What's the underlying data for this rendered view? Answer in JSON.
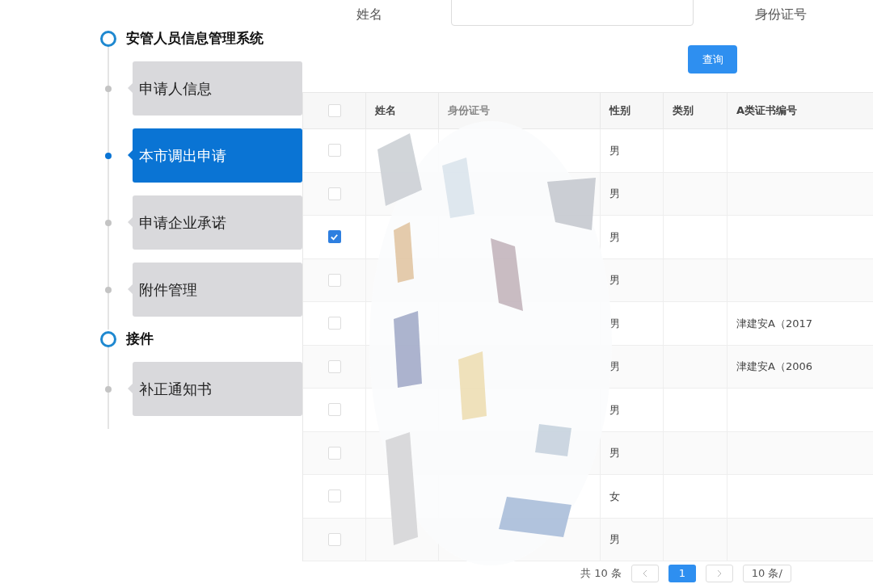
{
  "sidebar": {
    "groups": [
      {
        "title": "安管人员信息管理系统",
        "items": [
          {
            "label": "申请人信息",
            "selected": false
          },
          {
            "label": "本市调出申请",
            "selected": true
          },
          {
            "label": "申请企业承诺",
            "selected": false
          },
          {
            "label": "附件管理",
            "selected": false
          }
        ]
      },
      {
        "title": "接件",
        "items": [
          {
            "label": "补正通知书",
            "selected": false
          }
        ]
      }
    ]
  },
  "search_form": {
    "fields": [
      {
        "label": "姓名",
        "has_input": true
      },
      {
        "label": "身份证号",
        "has_input": false
      }
    ],
    "button": "查询"
  },
  "table": {
    "header_checked": false,
    "columns": [
      "姓名",
      "身份证号",
      "性别",
      "类别",
      "A类证书编号"
    ],
    "rows": [
      {
        "checked": false,
        "gender": "男"
      },
      {
        "checked": false,
        "gender": "男"
      },
      {
        "checked": true,
        "gender": "男"
      },
      {
        "checked": false,
        "gender": "男"
      },
      {
        "checked": false,
        "gender": "男",
        "cert": "津建安A（2017"
      },
      {
        "checked": false,
        "gender": "男",
        "cert": "津建安A（2006"
      },
      {
        "checked": false,
        "gender": "男"
      },
      {
        "checked": false,
        "gender": "男"
      },
      {
        "checked": false,
        "gender": "女"
      },
      {
        "checked": false,
        "gender": "男"
      }
    ]
  },
  "pagination": {
    "total": "共 10 条",
    "pages": [
      {
        "label": "1",
        "selected": true
      }
    ],
    "page_size": "10 条/"
  }
}
